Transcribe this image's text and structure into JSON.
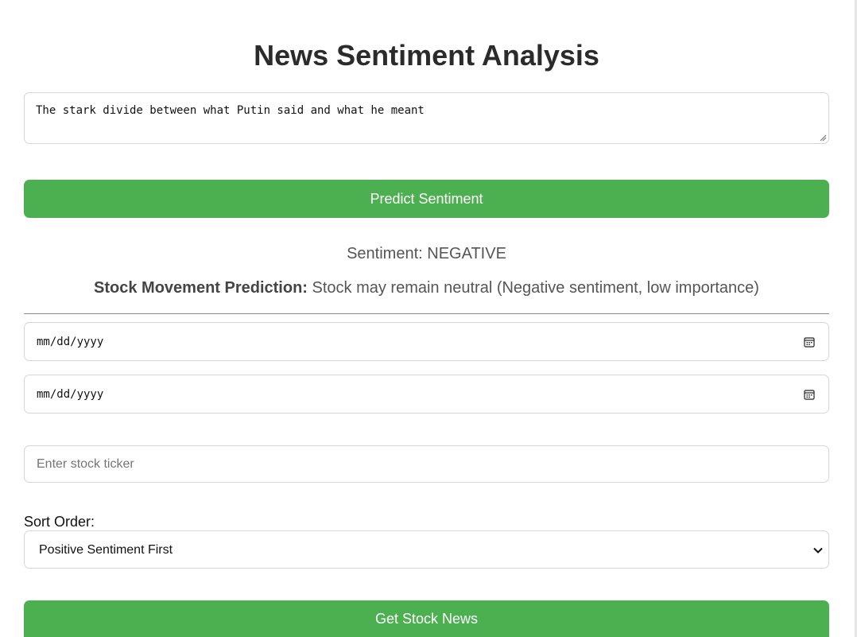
{
  "page": {
    "title": "News Sentiment Analysis"
  },
  "predict": {
    "headline_value": "The stark divide between what Putin said and what he meant",
    "button_label": "Predict Sentiment"
  },
  "result": {
    "sentiment": "Sentiment: NEGATIVE",
    "movement_label": "Stock Movement Prediction:",
    "movement_value": " Stock may remain neutral (Negative sentiment, low importance)"
  },
  "filters": {
    "start_date_placeholder": "mm/dd/yyyy",
    "end_date_placeholder": "mm/dd/yyyy",
    "ticker_placeholder": "Enter stock ticker",
    "sort_label": "Sort Order:",
    "sort_selected": "Positive Sentiment First",
    "get_news_label": "Get Stock News"
  },
  "icons": {
    "calendar": "calendar-icon",
    "chevron": "chevron-down-icon",
    "resize": "resize-grip-icon"
  },
  "colors": {
    "accent": "#4caf50",
    "button_text": "#ffffff",
    "border": "#d6d6d6"
  }
}
